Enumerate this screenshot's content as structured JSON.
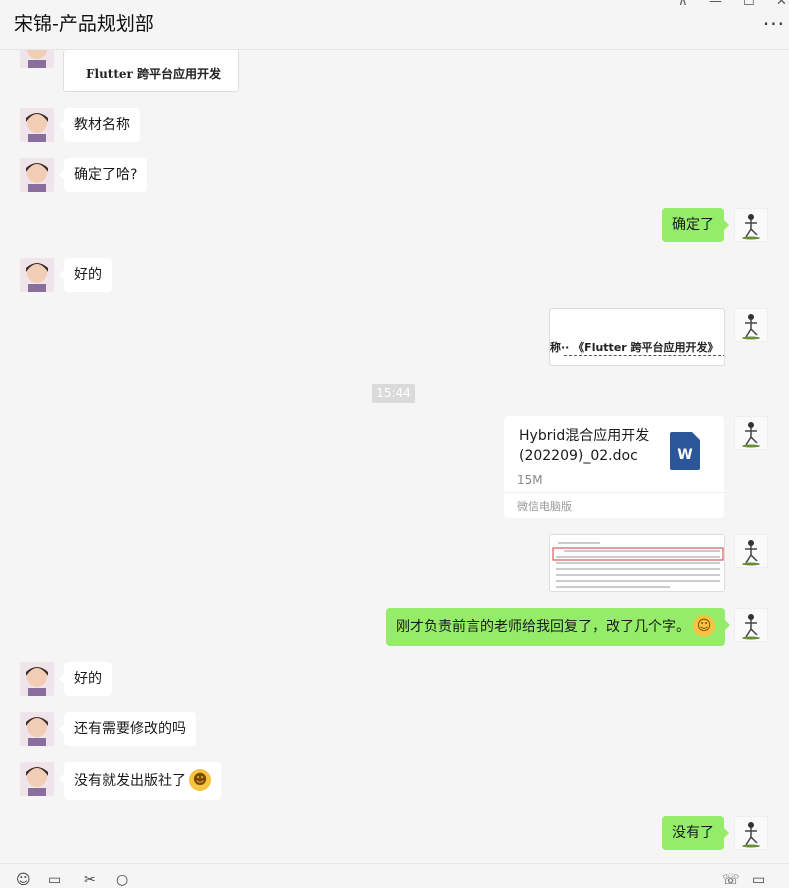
{
  "window": {
    "title": "宋锦-产品规划部",
    "controls": {
      "pin": "⊼",
      "minimize": "—",
      "maximize": "☐",
      "close": "✕"
    },
    "more": "···"
  },
  "messages": {
    "m1_image_text": "Flutter 跨平台应用开发",
    "m2": "教材名称",
    "m3": "确定了哈?",
    "m4": "确定了",
    "m5": "好的",
    "m6_image_text": "称·· 《Flutter 跨平台应用开发》",
    "timestamp": "15:44",
    "file": {
      "name": "Hybrid混合应用开发(202209)_02.doc",
      "size": "15M",
      "source": "微信电脑版",
      "icon_letter": "W",
      "icon_color": "#2b579a"
    },
    "m8": "刚才负责前言的老师给我回复了，改了几个字。",
    "m8_emoji": "emoji-laugh-cry",
    "m9": "好的",
    "m10": "还有需要修改的吗",
    "m11": "没有就发出版社了",
    "m11_emoji": "emoji-grin",
    "m12": "没有了"
  },
  "toolbar": {
    "items": [
      "emoji-icon",
      "folder-icon",
      "scissors-icon",
      "chat-icon",
      "phone-icon",
      "video-icon"
    ]
  },
  "colors": {
    "sent_bubble": "#95ec69",
    "received_bubble": "#ffffff",
    "background": "#f5f5f5"
  }
}
